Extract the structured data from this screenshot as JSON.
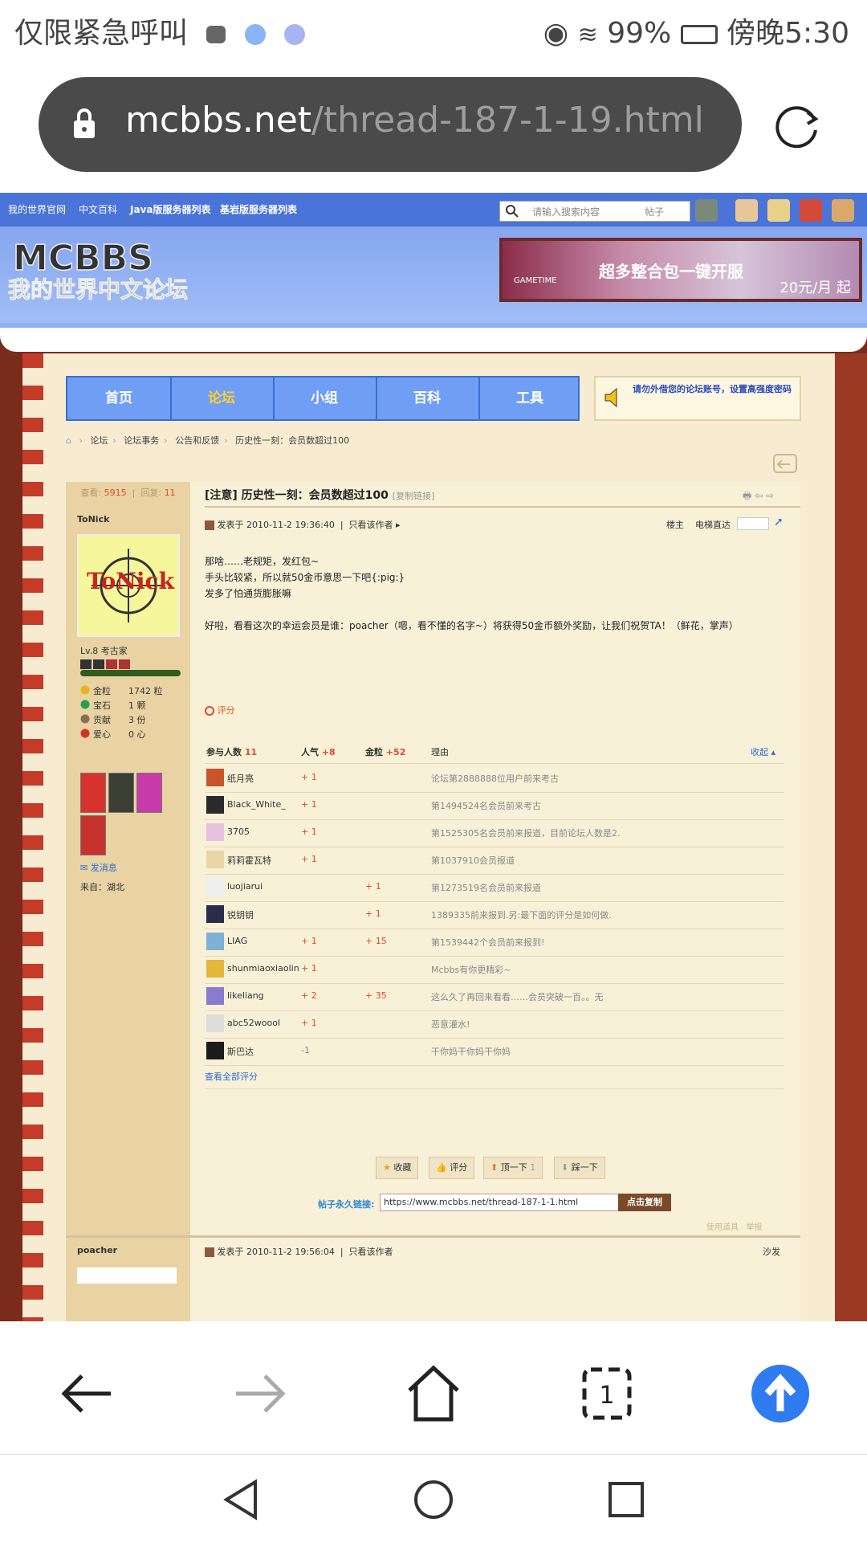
{
  "status_bar": {
    "left_text": "仅限紧急呼叫",
    "battery": "99%",
    "time": "傍晚5:30"
  },
  "url_bar": {
    "domain": "mcbbs.net",
    "path": "/thread-187-1-19.html"
  },
  "site_top_nav": [
    "我的世界官网",
    "中文百科",
    "Java版服务器列表",
    "基岩版服务器列表"
  ],
  "search": {
    "placeholder": "请输入搜索内容",
    "type": "帖子"
  },
  "banner_ad": {
    "title": "超多整合包一键开服",
    "price": "20元/月 起",
    "brand": "GAMETIME"
  },
  "logo_text": "MCBBS 我的世界中文论坛",
  "main_nav": [
    "首页",
    "论坛",
    "小组",
    "百科",
    "工具"
  ],
  "notice": "请勿外借您的论坛账号，设置高强度密码",
  "breadcrumb": [
    "论坛",
    "论坛事务",
    "公告和反馈",
    "历史性一刻：会员数超过100"
  ],
  "post": {
    "views_label": "查看:",
    "views": "5915",
    "replies_label": "回复:",
    "replies": "11",
    "title": "[注意] 历史性一刻：会员数超过100",
    "copy_link": "[复制链接]",
    "author": "ToNick",
    "level": "Lv.8 考古家",
    "stats": [
      {
        "k": "金粒",
        "v": "1742 粒"
      },
      {
        "k": "宝石",
        "v": "1 颗"
      },
      {
        "k": "贡献",
        "v": "3 份"
      },
      {
        "k": "爱心",
        "v": "0 心"
      }
    ],
    "send_message": "发消息",
    "from": "来自：湖北",
    "posted": "发表于 2010-11-2 19:36:40",
    "only_author": "只看该作者",
    "floor": "楼主",
    "elevator": "电梯直达",
    "body": [
      "那啥……老规矩，发红包~",
      "手头比较紧，所以就50金币意思一下吧{:pig:}",
      "发多了怕通货膨胀嘛",
      "",
      "好啦，看看这次的幸运会员是谁：poacher（嗯，看不懂的名字~）将获得50金币额外奖励，让我们祝贺TA！（鲜花，掌声）"
    ],
    "rate_label": "评分"
  },
  "ratings": {
    "header": {
      "participants": "参与人数",
      "participants_count": "11",
      "popularity": "人气",
      "popularity_total": "+8",
      "gold": "金粒",
      "gold_total": "+52",
      "reason": "理由",
      "collapse": "收起"
    },
    "rows": [
      {
        "name": "纸月亮",
        "pop": "+ 1",
        "gold": "",
        "reason": "论坛第2888888位用户前来考古",
        "color": "#c8562a"
      },
      {
        "name": "Black_White_",
        "pop": "+ 1",
        "gold": "",
        "reason": "第1494524名会员前来考古",
        "color": "#2a2a2a"
      },
      {
        "name": "3705",
        "pop": "+ 1",
        "gold": "",
        "reason": "第1525305名会员前来报道，目前论坛人数是2.",
        "color": "#e6c2e0"
      },
      {
        "name": "莉莉霍瓦特",
        "pop": "+ 1",
        "gold": "",
        "reason": "第1037910会员报道",
        "color": "#e8d6a8"
      },
      {
        "name": "luojiarui",
        "pop": "",
        "gold": "+ 1",
        "reason": "第1273519名会员前来报道",
        "color": "#efefef"
      },
      {
        "name": "锐钥钥",
        "pop": "",
        "gold": "+ 1",
        "reason": "1389335前来报到.另:最下面的评分是如何做.",
        "color": "#2b2b4a"
      },
      {
        "name": "LIAG",
        "pop": "+ 1",
        "gold": "+ 15",
        "reason": "第1539442个会员前来报到!",
        "color": "#7fb0d8"
      },
      {
        "name": "shunmiaoxiaolin",
        "pop": "+ 1",
        "gold": "",
        "reason": "Mcbbs有你更精彩~",
        "color": "#e3b83a"
      },
      {
        "name": "likeliang",
        "pop": "+ 2",
        "gold": "+ 35",
        "reason": "这么久了再回来看看……会员突破一百。。无",
        "color": "#8a7ad0"
      },
      {
        "name": "abc52woool",
        "pop": "+ 1",
        "gold": "",
        "reason": "恶意灌水!",
        "color": "#dcdcdc"
      },
      {
        "name": "斯巴达",
        "pop": "-1",
        "gold": "",
        "reason": "干你妈干你妈干你妈",
        "color": "#1c1c1c"
      }
    ],
    "view_all": "查看全部评分"
  },
  "actions": [
    {
      "label": "收藏",
      "icon": "star-icon"
    },
    {
      "label": "评分",
      "icon": "thumb-icon"
    },
    {
      "label": "顶一下",
      "count": "1",
      "icon": "up-arrow-icon"
    },
    {
      "label": "踩一下",
      "icon": "down-arrow-icon"
    }
  ],
  "permalink": {
    "label": "帖子永久链接:",
    "url": "https://www.mcbbs.net/thread-187-1-1.html",
    "copy": "点击复制"
  },
  "tools": "使用道具 ·  举报",
  "reply": {
    "author": "poacher",
    "posted": "发表于 2010-11-2 19:56:04",
    "only_author": "只看该作者",
    "floor": "沙发"
  },
  "colors": {
    "accent_blue": "#2f7bf0",
    "frame_red": "#7a2b1c",
    "nav_blue": "#6f9ef4"
  }
}
